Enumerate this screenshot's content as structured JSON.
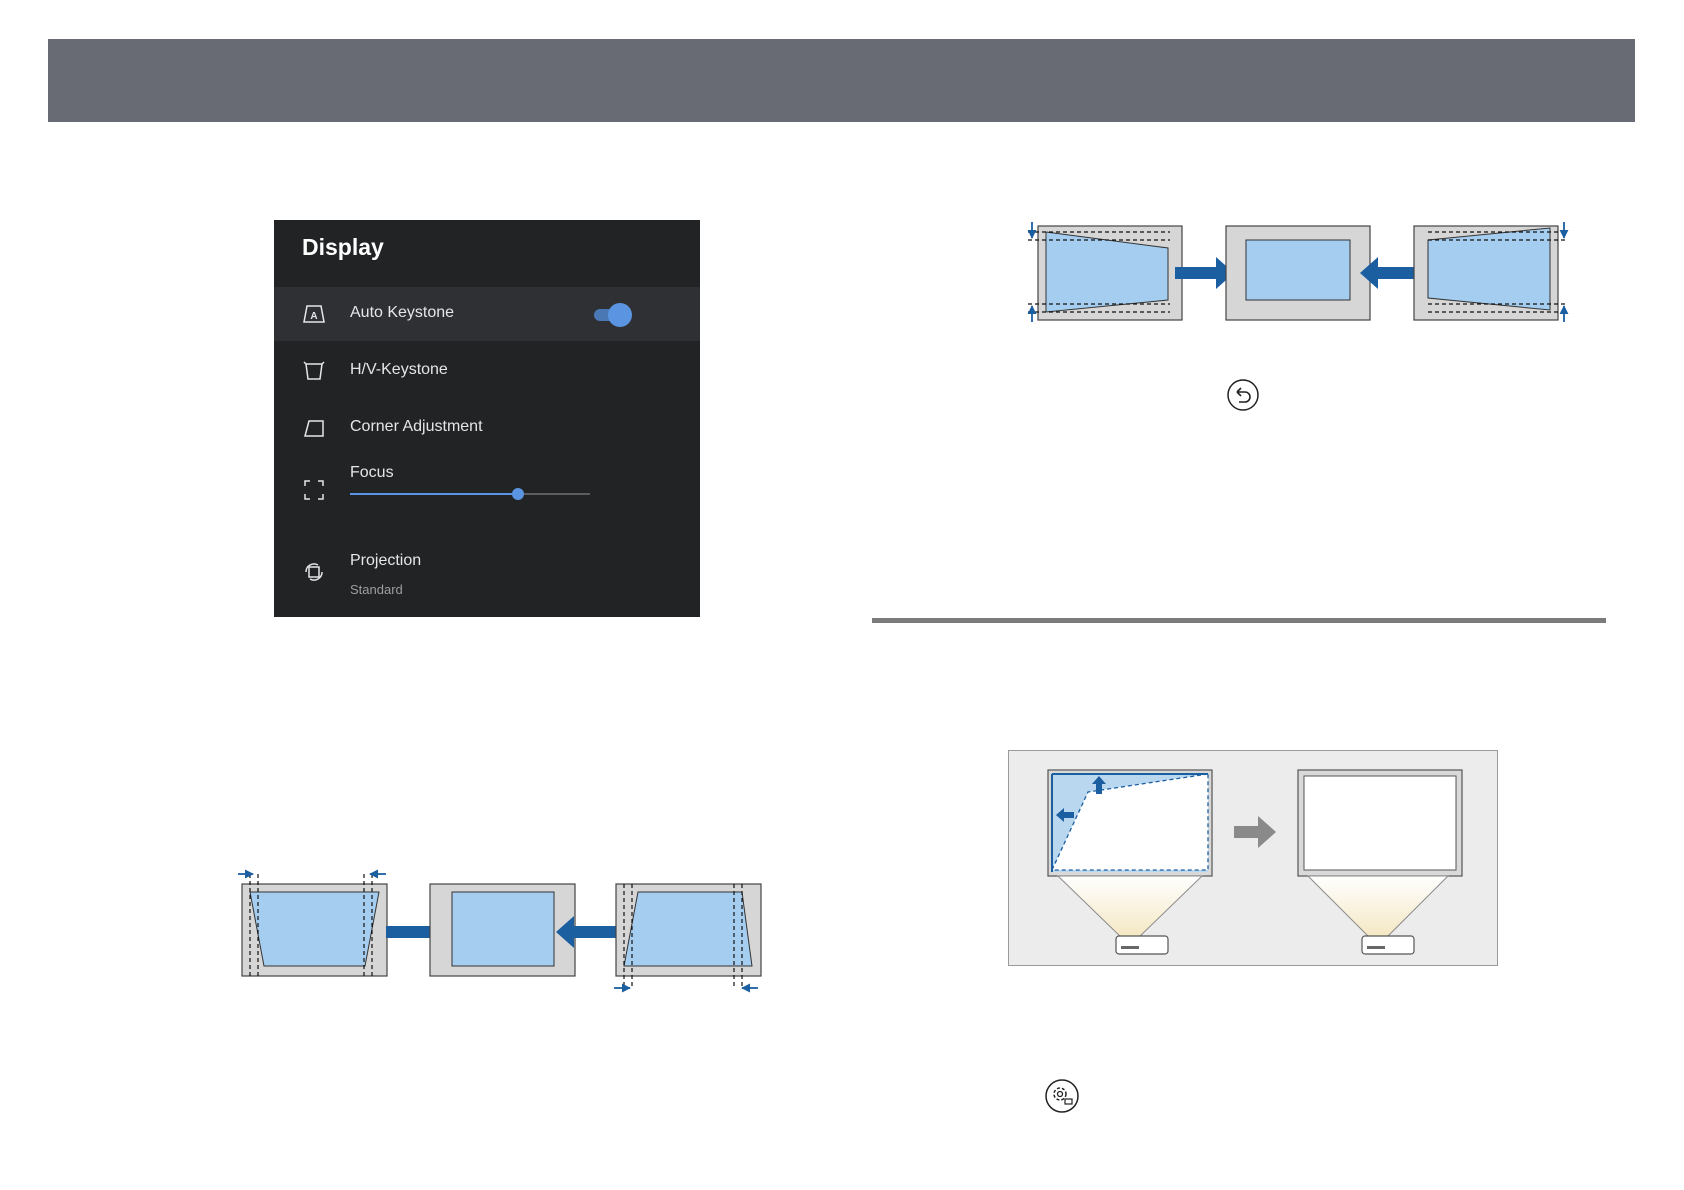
{
  "menu": {
    "title": "Display",
    "items": [
      {
        "label": "Auto Keystone",
        "icon": "auto-keystone-icon",
        "toggle_on": true
      },
      {
        "label": "H/V-Keystone",
        "icon": "hv-keystone-icon"
      },
      {
        "label": "Corner Adjustment",
        "icon": "corner-adjustment-icon"
      },
      {
        "label": "Focus",
        "icon": "focus-icon",
        "slider_level": 0.7
      },
      {
        "label": "Projection",
        "icon": "projection-icon",
        "value": "Standard"
      }
    ],
    "colors": {
      "background": "#222325",
      "accent": "#5b95e1"
    }
  },
  "figures": {
    "screen_fill": "#a4cdf0",
    "frame_fill": "#d6d6d6",
    "arrow_color": "#1b5fa0",
    "inline_icons": [
      "return-button-icon",
      "settings-remote-button-icon"
    ]
  }
}
